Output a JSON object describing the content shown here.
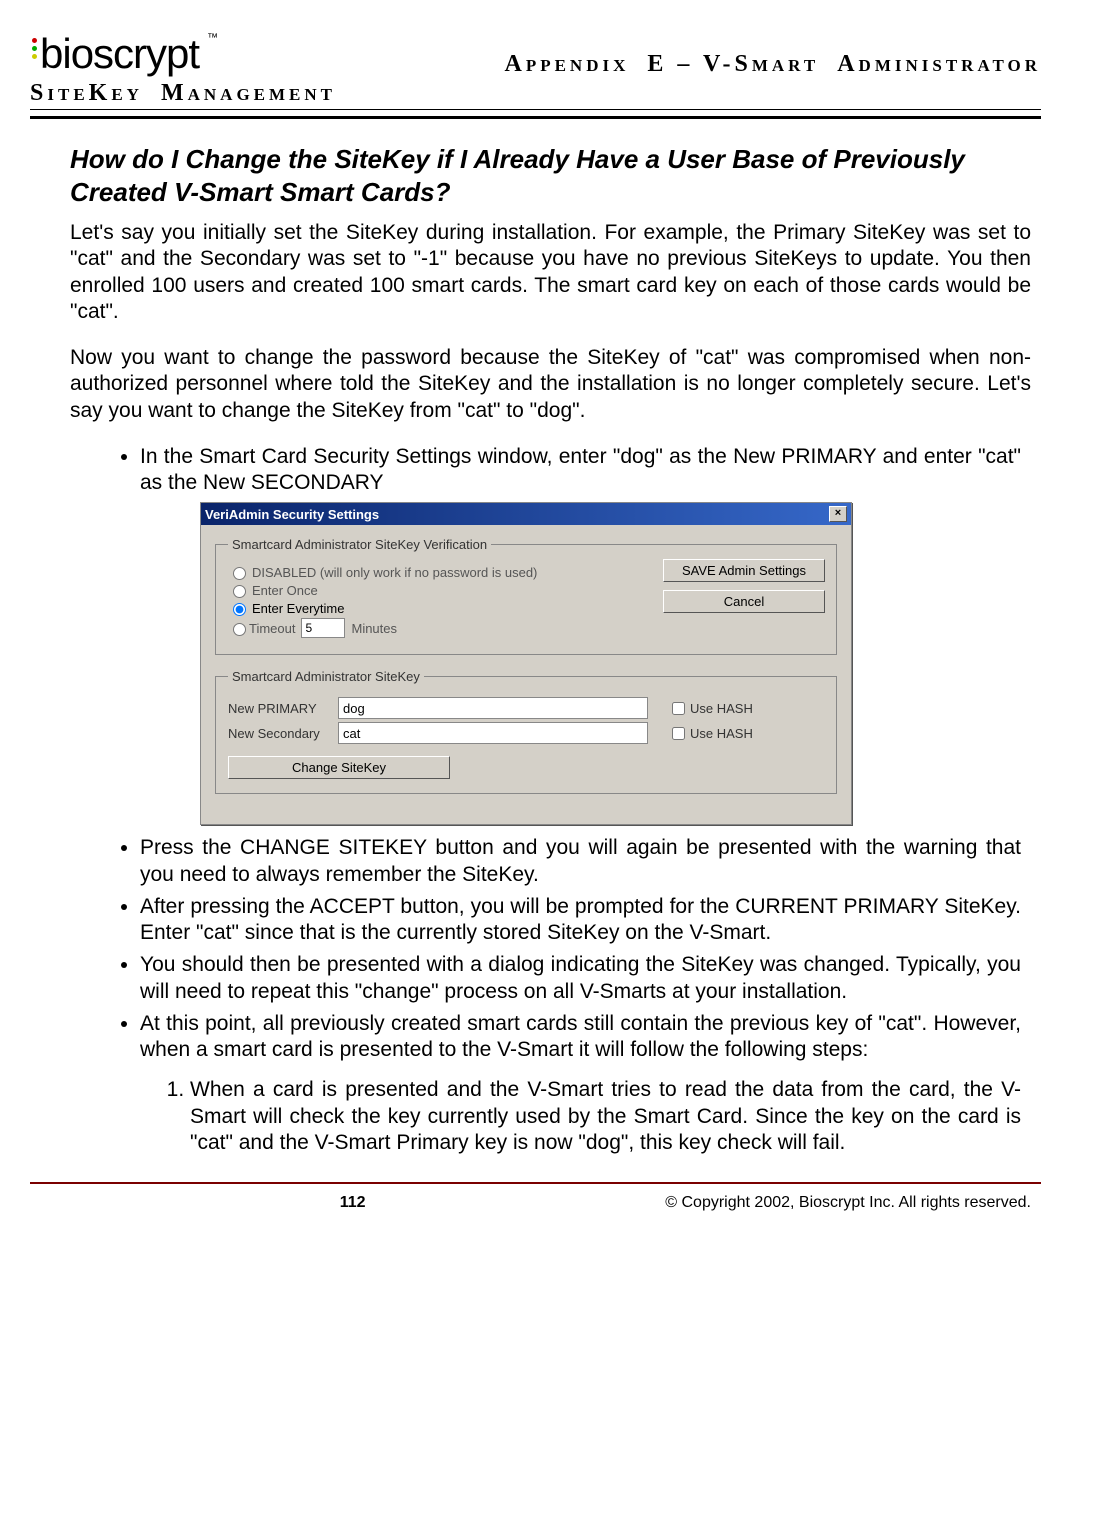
{
  "header": {
    "logo_text": "bioscrypt",
    "tm": "™",
    "line1_prefix": "A",
    "line1_rest": "PPENDIX",
    "line1_e": "E –  V-S",
    "line1_tail": "MART",
    "line1_admin_a": "A",
    "line1_admin_rest": "DMINISTRATOR",
    "line2_s": "S",
    "line2_ite": "ITE",
    "line2_k": "K",
    "line2_ey": "EY",
    "line2_m": "M",
    "line2_rest": "ANAGEMENT"
  },
  "title": "How do I Change the SiteKey if I Already Have a User Base of Previously Created V-Smart Smart Cards?",
  "paragraphs": {
    "p1": "Let's say you initially set the SiteKey during installation.  For example, the Primary SiteKey was set to \"cat\" and the Secondary was set to \"-1\" because you have no previous SiteKeys to update.  You then enrolled 100 users and created 100 smart cards.  The smart card key on each of those cards would be \"cat\".",
    "p2": "Now you want to change the password because the SiteKey of \"cat\" was compromised when non-authorized personnel where told the SiteKey and the installation is no longer completely secure.   Let's say you want to change the SiteKey from \"cat\" to \"dog\"."
  },
  "bullet1": "In the Smart Card Security Settings window, enter \"dog\" as the New PRIMARY and enter \"cat\" as the New SECONDARY",
  "dialog": {
    "title": "VeriAdmin Security Settings",
    "close": "×",
    "group1_legend": "Smartcard Administrator SiteKey Verification",
    "opt_disabled": "DISABLED (will only work if no password is used)",
    "opt_once": "Enter Once",
    "opt_every": "Enter Everytime",
    "opt_timeout": "Timeout",
    "timeout_value": "5",
    "timeout_unit": "Minutes",
    "btn_save": "SAVE Admin Settings",
    "btn_cancel": "Cancel",
    "group2_legend": "Smartcard Administrator SiteKey",
    "new_primary_label": "New PRIMARY",
    "new_primary_value": "dog",
    "new_secondary_label": "New Secondary",
    "new_secondary_value": "cat",
    "use_hash": "Use HASH",
    "btn_change": "Change SiteKey"
  },
  "bullets_after": {
    "b2": "Press the CHANGE SITEKEY button and you will again be presented with the warning that you need to always remember the SiteKey.",
    "b3": "After pressing the ACCEPT button, you will be prompted for the CURRENT PRIMARY SiteKey.  Enter \"cat\" since that is the currently stored SiteKey on the V-Smart.",
    "b4": "You should then be presented with a dialog indicating the SiteKey was changed.  Typically, you will need to repeat this \"change\" process on all V-Smarts at your installation.",
    "b5": "At this point, all previously created smart cards still contain the previous key of \"cat\".  However, when a smart card is presented to the V-Smart it will follow the following steps:"
  },
  "numbered": {
    "n1": "When a card is presented and the V-Smart tries to read the data from the card, the V-Smart will check the key currently used by the Smart Card.  Since the key on the card is \"cat\" and the V-Smart Primary key is now \"dog\", this key check will fail."
  },
  "footer": {
    "page": "112",
    "copyright": "© Copyright 2002, Bioscrypt Inc.  All rights reserved."
  }
}
